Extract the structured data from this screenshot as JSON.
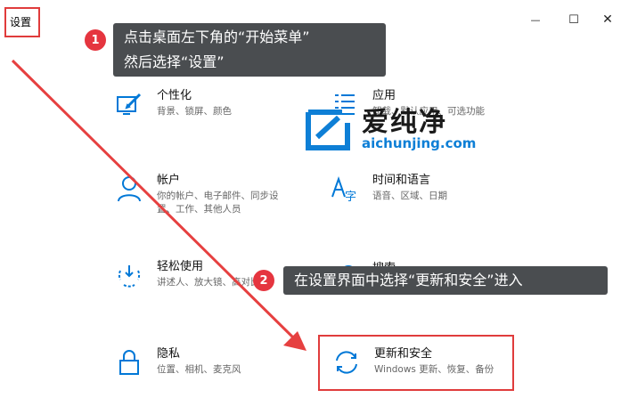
{
  "window": {
    "title": "设置",
    "minimize_glyph": "—",
    "maximize_glyph": "☐",
    "close_glyph": "✕"
  },
  "settings": {
    "personalization": {
      "title": "个性化",
      "desc": [
        "背景、锁屏、颜色"
      ],
      "icon": "personalization-icon"
    },
    "apps": {
      "title": "应用",
      "desc": [
        "卸载、默认应用、可选功能"
      ],
      "icon": "apps-list-icon"
    },
    "accounts": {
      "title": "帐户",
      "desc": [
        "你的帐户、电子邮件、同步设",
        "置、工作、其他人员"
      ],
      "icon": "account-person-icon"
    },
    "time_language": {
      "title": "时间和语言",
      "desc": [
        "语音、区域、日期"
      ],
      "icon": "time-language-icon"
    },
    "ease_of_access": {
      "title": "轻松使用",
      "desc": [
        "讲述人、放大镜、高对比度"
      ],
      "icon": "ease-of-access-icon"
    },
    "search": {
      "title": "搜索",
      "desc": [],
      "icon": "search-icon"
    },
    "privacy": {
      "title": "隐私",
      "desc": [
        "位置、相机、麦克风"
      ],
      "icon": "lock-icon"
    },
    "update_security": {
      "title": "更新和安全",
      "desc": [
        "Windows 更新、恢复、备份"
      ],
      "icon": "sync-arrows-icon"
    }
  },
  "annotations": {
    "step1": {
      "number": "1",
      "lines": [
        "点击桌面左下角的“开始菜单”",
        "然后选择“设置”"
      ]
    },
    "step2": {
      "number": "2",
      "text": "在设置界面中选择“更新和安全”进入"
    }
  },
  "watermark": {
    "text": "爱纯净",
    "url": "aichunjing.com"
  },
  "colors": {
    "accent": "#0078d7",
    "highlight_red": "#e03c3c",
    "tooltip_bg": "#4a4d50"
  }
}
